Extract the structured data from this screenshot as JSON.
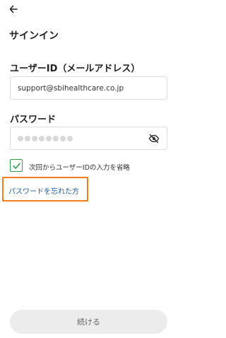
{
  "header": {
    "back_icon": "arrow-left-icon",
    "title": "サインイン"
  },
  "form": {
    "user_id_label": "ユーザーID（メールアドレス）",
    "user_id_value": "support@sbihealthcare.co.jp",
    "password_label": "パスワード",
    "password_mask_count": 8,
    "password_toggle_icon": "eye-off-icon",
    "remember_checked": true,
    "remember_label": "次回からユーザーIDの入力を省略",
    "forgot_link": "パスワードを忘れた方"
  },
  "footer": {
    "submit_label": "続ける"
  },
  "colors": {
    "checkbox_green": "#2e9e4f",
    "link_blue": "#1b5fae",
    "highlight_orange": "#f57c1f",
    "button_bg": "#ececec"
  }
}
